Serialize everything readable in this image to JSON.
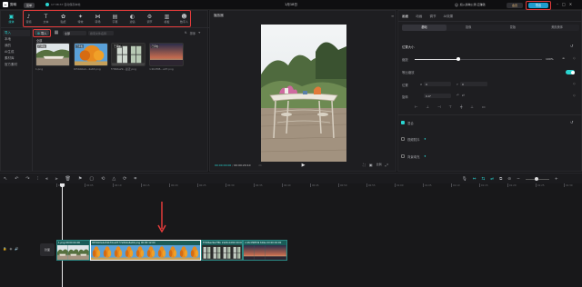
{
  "app": {
    "logo_text": "剪映",
    "menu_label": "菜单",
    "autosave_text": "17:38:37 自动保存本地",
    "project_title": "1月18日",
    "share_label": "加入剪映公测,云赚钱",
    "vip_label": "会员",
    "export_label": "导出"
  },
  "toolbar": [
    {
      "icon": "media-icon",
      "label": "媒体",
      "active": true
    },
    {
      "icon": "audio-icon",
      "label": "音频"
    },
    {
      "icon": "text-icon",
      "label": "文本"
    },
    {
      "icon": "sticker-icon",
      "label": "贴纸"
    },
    {
      "icon": "effects-icon",
      "label": "特效"
    },
    {
      "icon": "transition-icon",
      "label": "转场"
    },
    {
      "icon": "caption-icon",
      "label": "字幕"
    },
    {
      "icon": "filter-icon",
      "label": "滤镜"
    },
    {
      "icon": "adjust-icon",
      "label": "调节"
    },
    {
      "icon": "template-icon",
      "label": "模板"
    },
    {
      "icon": "digital-human-icon",
      "label": "数字人"
    }
  ],
  "sidebar": {
    "items": [
      {
        "label": "导入",
        "active": true
      },
      {
        "label": "本地"
      },
      {
        "label": "我的"
      },
      {
        "label": "AI生成"
      },
      {
        "label": "素材库"
      },
      {
        "label": "官方素材"
      }
    ]
  },
  "media": {
    "import_label": "导入",
    "filter_label": "全部",
    "search_placeholder": "搜索文件名称",
    "sort_label": "排序",
    "all_label": "全部",
    "items": [
      {
        "name": "1.png",
        "badge": "已添加",
        "kind": "terrace"
      },
      {
        "name": "005bb0a4...4a63.png",
        "badge": "已添加",
        "kind": "autumn"
      },
      {
        "name": "f7996a29...最近.png",
        "badge": "已添加",
        "kind": "window"
      },
      {
        "name": "cc2b4f98...e97.png",
        "badge": "已添加",
        "kind": "sunset"
      }
    ]
  },
  "player": {
    "title": "播放器",
    "current_time": "00:00:00:00",
    "total_time": "00:00:20:10",
    "ratio_label": "比例"
  },
  "inspector": {
    "tabs": [
      {
        "label": "画面",
        "active": true
      },
      {
        "label": "动画"
      },
      {
        "label": "调节"
      },
      {
        "label": "AI效果"
      }
    ],
    "subtabs": [
      {
        "label": "基础",
        "active": true
      },
      {
        "label": "抠像"
      },
      {
        "label": "蒙版"
      },
      {
        "label": "美颜美体"
      }
    ],
    "section_position": "位置大小",
    "scale_label": "缩放",
    "scale_value": "100%",
    "lock_ratio_label": "等比缩放",
    "position_label": "位置",
    "position_x": "0",
    "position_y": "0",
    "rotate_label": "旋转",
    "rotate_value": "0.0°",
    "blend_label": "混合",
    "stabilize_label": "视频防抖",
    "section_bg": "背景填充"
  },
  "timeline": {
    "ruler": [
      "00:00",
      "00:05",
      "00:10",
      "00:15",
      "00:20",
      "00:25",
      "00:30",
      "00:35",
      "00:40",
      "00:45",
      "00:50",
      "00:55",
      "01:00",
      "01:05",
      "01:10",
      "01:15",
      "01:20",
      "01:25",
      "01:30"
    ],
    "track_label": "封面",
    "clips": [
      {
        "name": "1.png 00:00:04:00",
        "kind": "terrace"
      },
      {
        "name": "005bb0a4e54b76ca9777e8b4a6ab9.png 00:00:12:00",
        "kind": "autumn"
      },
      {
        "name": "f7996a29e7f8b 1920x1080 00:00:04:00",
        "kind": "window"
      },
      {
        "name": "cc2b4f98fd9 6b9e 00:00:04:00",
        "kind": "sunset"
      }
    ]
  },
  "colors": {
    "accent": "#2ad4d0",
    "highlight": "#e23b3b",
    "export_bg": "#1f9ecf"
  }
}
